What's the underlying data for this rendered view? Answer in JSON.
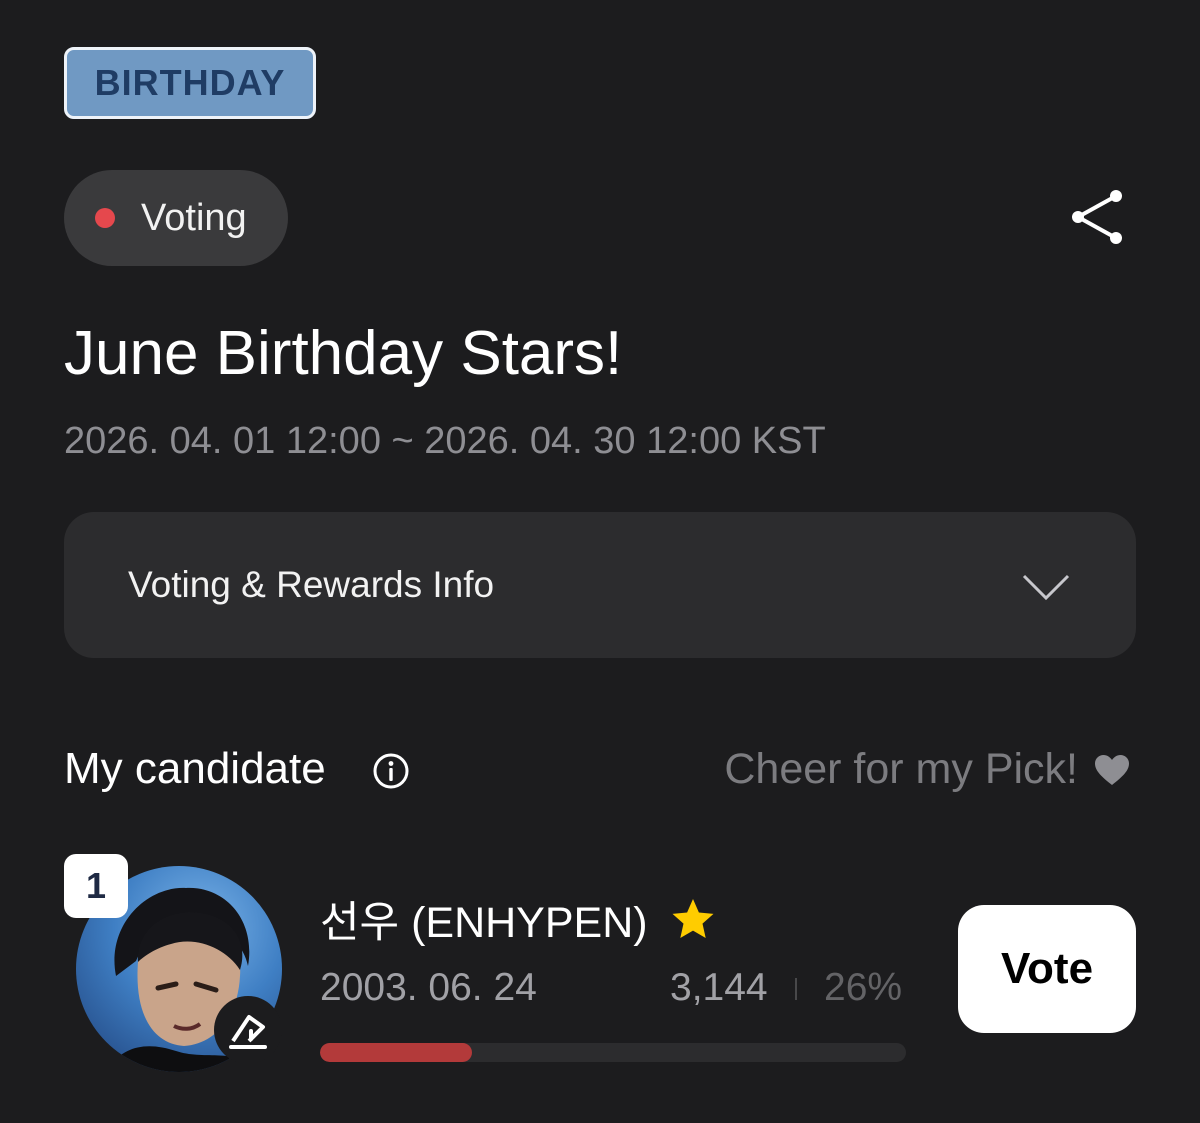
{
  "event": {
    "category": "BIRTHDAY",
    "status": "Voting",
    "status_color": "#e5484d",
    "title": "June Birthday Stars!",
    "period": "2026. 04. 01 12:00 ~ 2026. 04. 30 12:00 KST"
  },
  "header": {
    "share_icon": "share-icon"
  },
  "info_card": {
    "label": "Voting & Rewards Info",
    "icon": "chevron-down-icon"
  },
  "my_candidate": {
    "title": "My candidate",
    "info_icon": "info-icon",
    "cheer_label": "Cheer for my Pick!",
    "cheer_icon": "heart-icon"
  },
  "candidate": {
    "rank": "1",
    "name": "선우 (ENHYPEN)",
    "name_icon": "star-icon",
    "birthdate": "2003. 06. 24",
    "votes": "3,144",
    "percent": "26%",
    "progress": 0.26,
    "progress_color": "#b33a3a",
    "vote_label": "Vote"
  }
}
